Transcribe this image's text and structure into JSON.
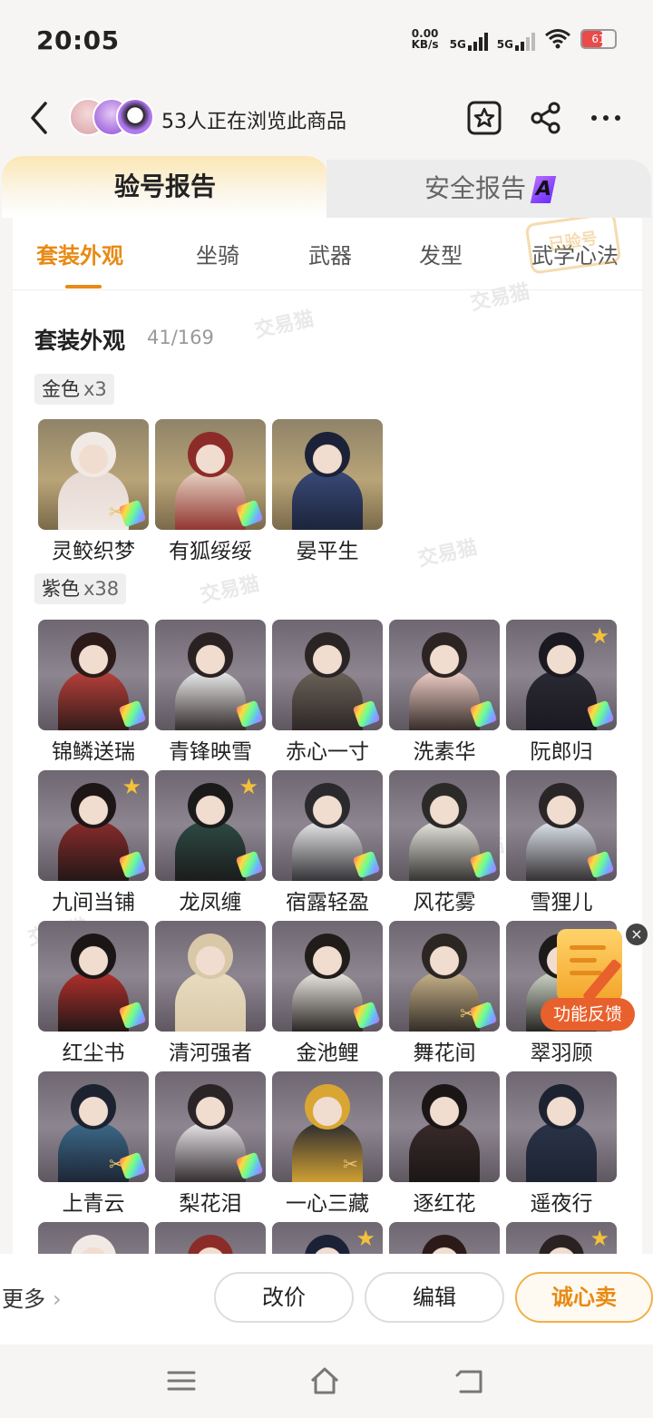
{
  "status_bar": {
    "time": "20:05",
    "net_speed_value": "0.00",
    "net_speed_unit": "KB/s",
    "signal1": "5G",
    "signal2": "5G",
    "battery": "61"
  },
  "header": {
    "title": "53人正在浏览此商品"
  },
  "report_tabs": {
    "yanhao": "验号报告",
    "anquan": "安全报告",
    "anquan_badge": "A"
  },
  "sub_tabs": [
    "套装外观",
    "坐骑",
    "武器",
    "发型",
    "武学心法"
  ],
  "stamp_text": "已验号",
  "watermark": "交易猫",
  "section": {
    "title": "套装外观",
    "count": "41/169",
    "gold_label": "金色",
    "gold_mul": "x3",
    "purple_label": "紫色",
    "purple_mul": "x38"
  },
  "gold_items": [
    {
      "name": "灵鲛织梦",
      "scissors": true,
      "rainbow": true,
      "star": false
    },
    {
      "name": "有狐绥绥",
      "scissors": false,
      "rainbow": true,
      "star": false
    },
    {
      "name": "晏平生",
      "scissors": false,
      "rainbow": false,
      "star": false
    }
  ],
  "purple_items": [
    {
      "name": "锦鳞送瑞",
      "rainbow": true,
      "star": false,
      "scissors": false
    },
    {
      "name": "青锋映雪",
      "rainbow": true,
      "star": false,
      "scissors": false
    },
    {
      "name": "赤心一寸",
      "rainbow": true,
      "star": false,
      "scissors": false
    },
    {
      "name": "洗素华",
      "rainbow": true,
      "star": false,
      "scissors": false
    },
    {
      "name": "阮郎归",
      "rainbow": true,
      "star": true,
      "scissors": false
    },
    {
      "name": "九间当铺",
      "rainbow": true,
      "star": true,
      "scissors": false
    },
    {
      "name": "龙凤缠",
      "rainbow": true,
      "star": true,
      "scissors": false
    },
    {
      "name": "宿露轻盈",
      "rainbow": true,
      "star": false,
      "scissors": false
    },
    {
      "name": "风花雾",
      "rainbow": true,
      "star": false,
      "scissors": false
    },
    {
      "name": "雪狸儿",
      "rainbow": true,
      "star": false,
      "scissors": false
    },
    {
      "name": "红尘书",
      "rainbow": true,
      "star": false,
      "scissors": false
    },
    {
      "name": "清河强者",
      "rainbow": false,
      "star": false,
      "scissors": false
    },
    {
      "name": "金池鲤",
      "rainbow": true,
      "star": false,
      "scissors": false
    },
    {
      "name": "舞花间",
      "rainbow": true,
      "star": false,
      "scissors": true
    },
    {
      "name": "翠羽顾",
      "rainbow": false,
      "star": false,
      "scissors": false
    },
    {
      "name": "上青云",
      "rainbow": true,
      "star": false,
      "scissors": true
    },
    {
      "name": "梨花泪",
      "rainbow": true,
      "star": false,
      "scissors": false
    },
    {
      "name": "一心三藏",
      "rainbow": false,
      "star": false,
      "scissors": true
    },
    {
      "name": "逐红花",
      "rainbow": false,
      "star": false,
      "scissors": false
    },
    {
      "name": "遥夜行",
      "rainbow": false,
      "star": false,
      "scissors": false
    },
    {
      "name": "",
      "rainbow": false,
      "star": false,
      "scissors": false
    },
    {
      "name": "",
      "rainbow": false,
      "star": false,
      "scissors": false
    },
    {
      "name": "",
      "rainbow": false,
      "star": true,
      "scissors": false
    },
    {
      "name": "",
      "rainbow": false,
      "star": false,
      "scissors": false
    },
    {
      "name": "",
      "rainbow": false,
      "star": true,
      "scissors": false
    }
  ],
  "feedback": {
    "label": "功能反馈",
    "close": "×"
  },
  "bottom": {
    "more": "更多",
    "more_chev": "›",
    "reprice": "改价",
    "edit": "编辑",
    "sell": "诚心卖"
  },
  "icons": {
    "back": "chevron-left-icon",
    "favorite": "star-bookmark-icon",
    "share": "share-icon",
    "menu": "more-dots-icon"
  },
  "colors": {
    "accent": "#e88a14",
    "star": "#f3c13a",
    "feedback": "#e8612c"
  }
}
